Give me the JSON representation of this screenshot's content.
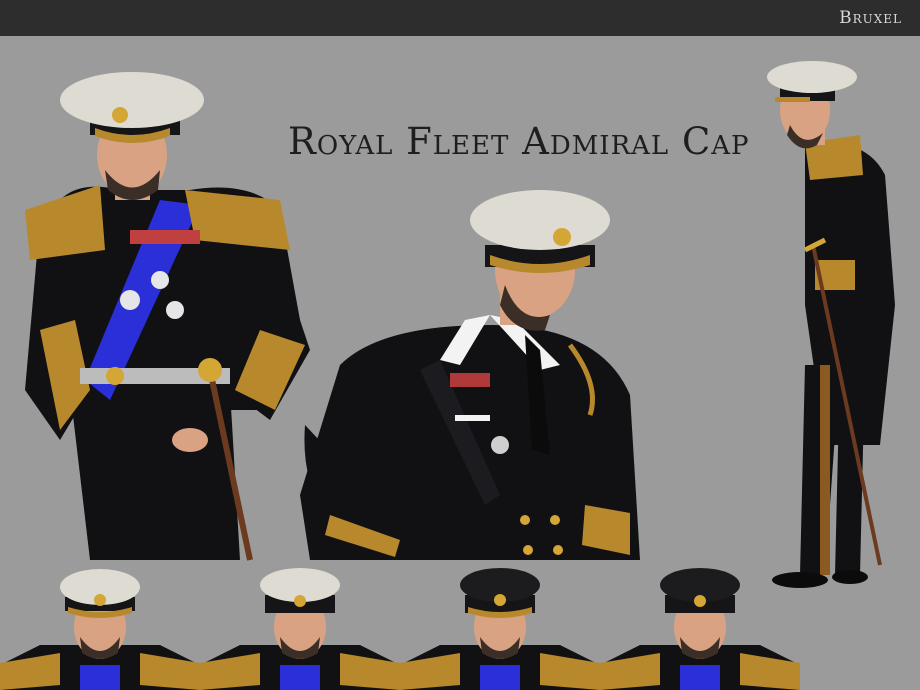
{
  "header": {
    "brand": "Bruxel"
  },
  "title": "Royal Fleet Admiral Cap",
  "colors": {
    "background": "#9b9b9b",
    "header_bar": "#2d2d2d",
    "uniform": "#111114",
    "gold": "#b8892c",
    "cap_white": "#dedbd2",
    "cap_black": "#151517",
    "sash_blue": "#2a2fd8",
    "skin": "#d9a383"
  },
  "thumbnails": [
    {
      "cap": "white"
    },
    {
      "cap": "white-black-band"
    },
    {
      "cap": "black"
    },
    {
      "cap": "black"
    }
  ]
}
